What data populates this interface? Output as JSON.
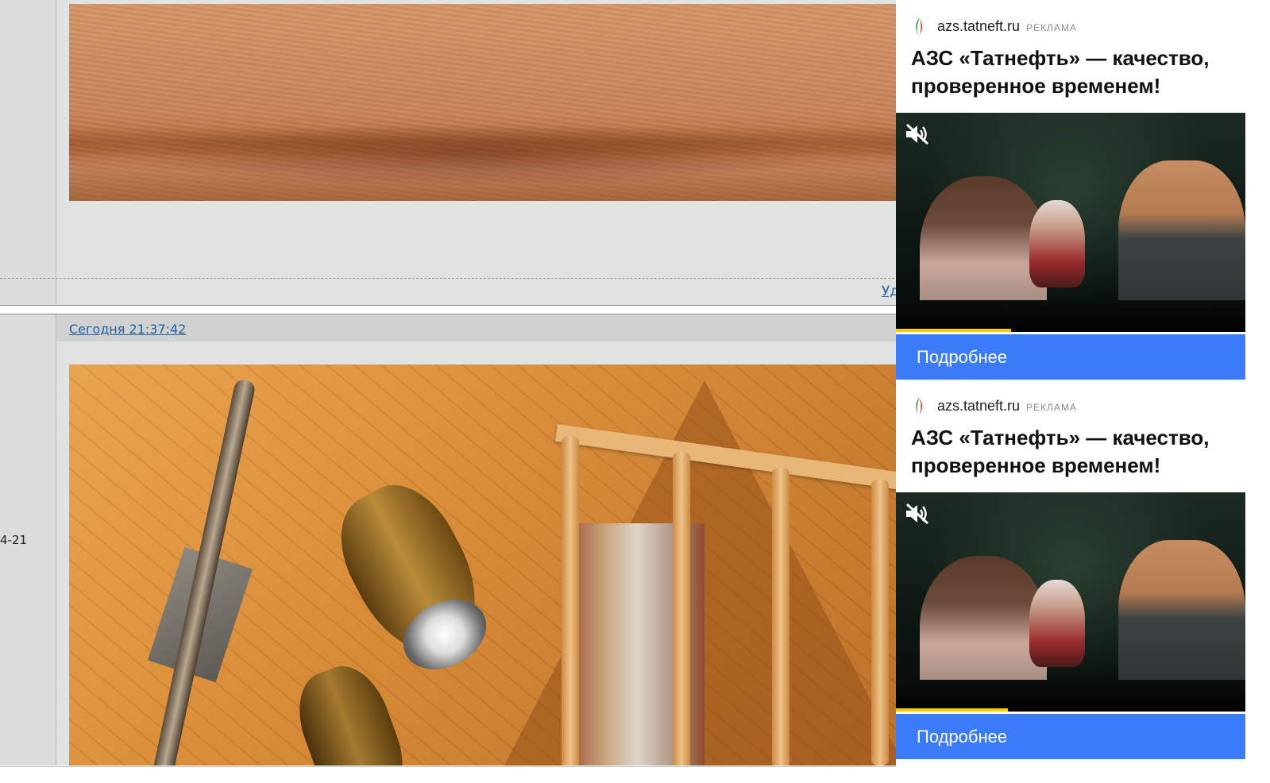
{
  "post1": {
    "delete_link": "Уд",
    "photo": "fabric-photo"
  },
  "post2": {
    "date_link": "Сегодня 21:37:42",
    "side_date": "4-21",
    "photo": "attic-lamp-photo"
  },
  "ads": [
    {
      "domain": "azs.tatneft.ru",
      "label": "РЕКЛАМА",
      "title": "АЗС «Татнефть» — качество, проверенное временем!",
      "button": "Подробнее",
      "progress": 0.33
    },
    {
      "domain": "azs.tatneft.ru",
      "label": "РЕКЛАМА",
      "title": "АЗС «Татнефть» — качество, проверенное временем!",
      "button": "Подробнее",
      "progress": 0.32
    }
  ],
  "colors": {
    "accent": "#3b7bf7",
    "link": "#1f5f9f",
    "progress": "#ffcc00",
    "post_bg": "#e1e3e3"
  },
  "icons": {
    "mute": "muted-speaker-icon",
    "logo": "tatneft-logo-icon"
  }
}
